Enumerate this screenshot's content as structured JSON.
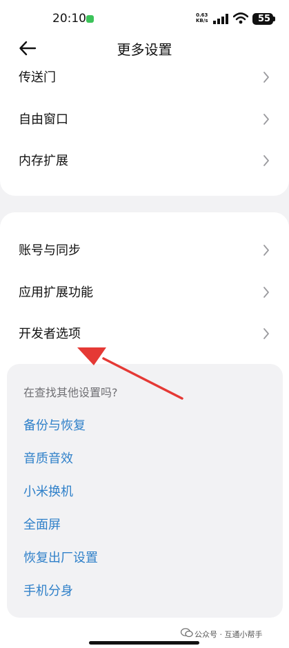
{
  "status_bar": {
    "time": "20:10",
    "speed_value": "0.63",
    "speed_unit": "KB/s",
    "battery": "55"
  },
  "header": {
    "title": "更多设置"
  },
  "group1": {
    "items": [
      {
        "label": "传送门"
      },
      {
        "label": "自由窗口"
      },
      {
        "label": "内存扩展"
      }
    ]
  },
  "group2": {
    "items": [
      {
        "label": "账号与同步"
      },
      {
        "label": "应用扩展功能"
      },
      {
        "label": "开发者选项"
      }
    ]
  },
  "suggestions": {
    "title": "在查找其他设置吗?",
    "links": [
      {
        "label": "备份与恢复"
      },
      {
        "label": "音质音效"
      },
      {
        "label": "小米换机"
      },
      {
        "label": "全面屏"
      },
      {
        "label": "恢复出厂设置"
      },
      {
        "label": "手机分身"
      }
    ]
  },
  "watermark": {
    "text": "公众号 · 互通小帮手"
  },
  "colors": {
    "link": "#2f80c9",
    "annotation_arrow": "#e53935",
    "page_background": "#f2f2f4"
  }
}
